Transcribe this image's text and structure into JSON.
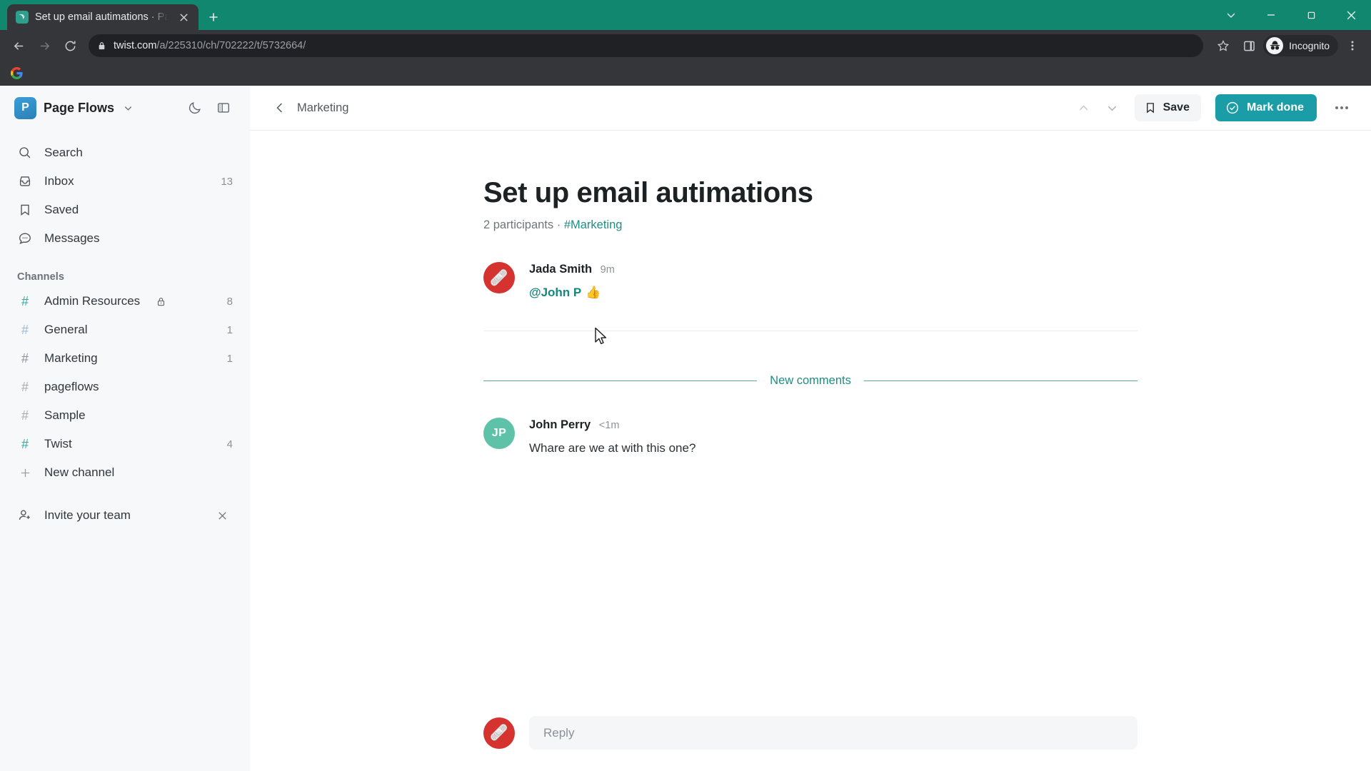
{
  "browser": {
    "tab": {
      "title": "Set up email autimations · Page",
      "favicon_name": "twist-favicon"
    },
    "newtab_label": "+",
    "url_host": "twist.com",
    "url_path": "/a/225310/ch/702222/t/5732664/",
    "profile_label": "Incognito",
    "window_controls": [
      "chevron-down",
      "minimize",
      "maximize",
      "close"
    ],
    "bookmarks": [
      {
        "name": "google-bookmark"
      }
    ]
  },
  "sidebar": {
    "workspace": {
      "initial": "P",
      "name": "Page Flows"
    },
    "theme_toggle_name": "dark-mode-moon",
    "panel_toggle_name": "toggle-sidebar-panel",
    "nav": [
      {
        "label": "Search",
        "icon": "search-icon",
        "badge": ""
      },
      {
        "label": "Inbox",
        "icon": "inbox-icon",
        "badge": "13"
      },
      {
        "label": "Saved",
        "icon": "bookmark-icon",
        "badge": ""
      },
      {
        "label": "Messages",
        "icon": "chat-bubble-icon",
        "badge": ""
      }
    ],
    "channels_heading": "Channels",
    "channels": [
      {
        "name": "Admin Resources",
        "badge": "8",
        "private": true,
        "hash_color": "#3aa99c"
      },
      {
        "name": "General",
        "badge": "1",
        "private": false,
        "hash_color": "#9cb9d9"
      },
      {
        "name": "Marketing",
        "badge": "1",
        "private": false,
        "hash_color": "#8d9399"
      },
      {
        "name": "pageflows",
        "badge": "",
        "private": false,
        "hash_color": "#a8adb2"
      },
      {
        "name": "Sample",
        "badge": "",
        "private": false,
        "hash_color": "#a8adb2"
      },
      {
        "name": "Twist",
        "badge": "4",
        "private": false,
        "hash_color": "#3aa99c"
      }
    ],
    "new_channel_label": "New channel",
    "invite_label": "Invite your team"
  },
  "toolbar": {
    "breadcrumb": "Marketing",
    "prev_label": "previous-thread",
    "next_label": "next-thread",
    "save_label": "Save",
    "mark_done_label": "Mark done",
    "more_label": "more-options"
  },
  "thread": {
    "title": "Set up email autimations",
    "participants": "2 participants",
    "separator": "·",
    "channel_tag": "#Marketing",
    "messages": [
      {
        "author": "Jada Smith",
        "time": "9m",
        "avatar_type": "emoji",
        "avatar_emoji": "🩹",
        "avatar_color": "#d5332f",
        "mention": "@John P",
        "text": "",
        "reaction": "👍"
      }
    ],
    "new_comments_label": "New comments",
    "comments": [
      {
        "author": "John Perry",
        "time": "<1m",
        "avatar_type": "initials",
        "avatar_initials": "JP",
        "avatar_color": "#5ec2a8",
        "text": "Whare are we at with this one?"
      }
    ]
  },
  "composer": {
    "placeholder": "Reply",
    "avatar_emoji": "🩹",
    "avatar_color": "#d5332f"
  },
  "colors": {
    "accent": "#1a9da6",
    "brand_green": "#10876e",
    "link_teal": "#1f8e85"
  }
}
